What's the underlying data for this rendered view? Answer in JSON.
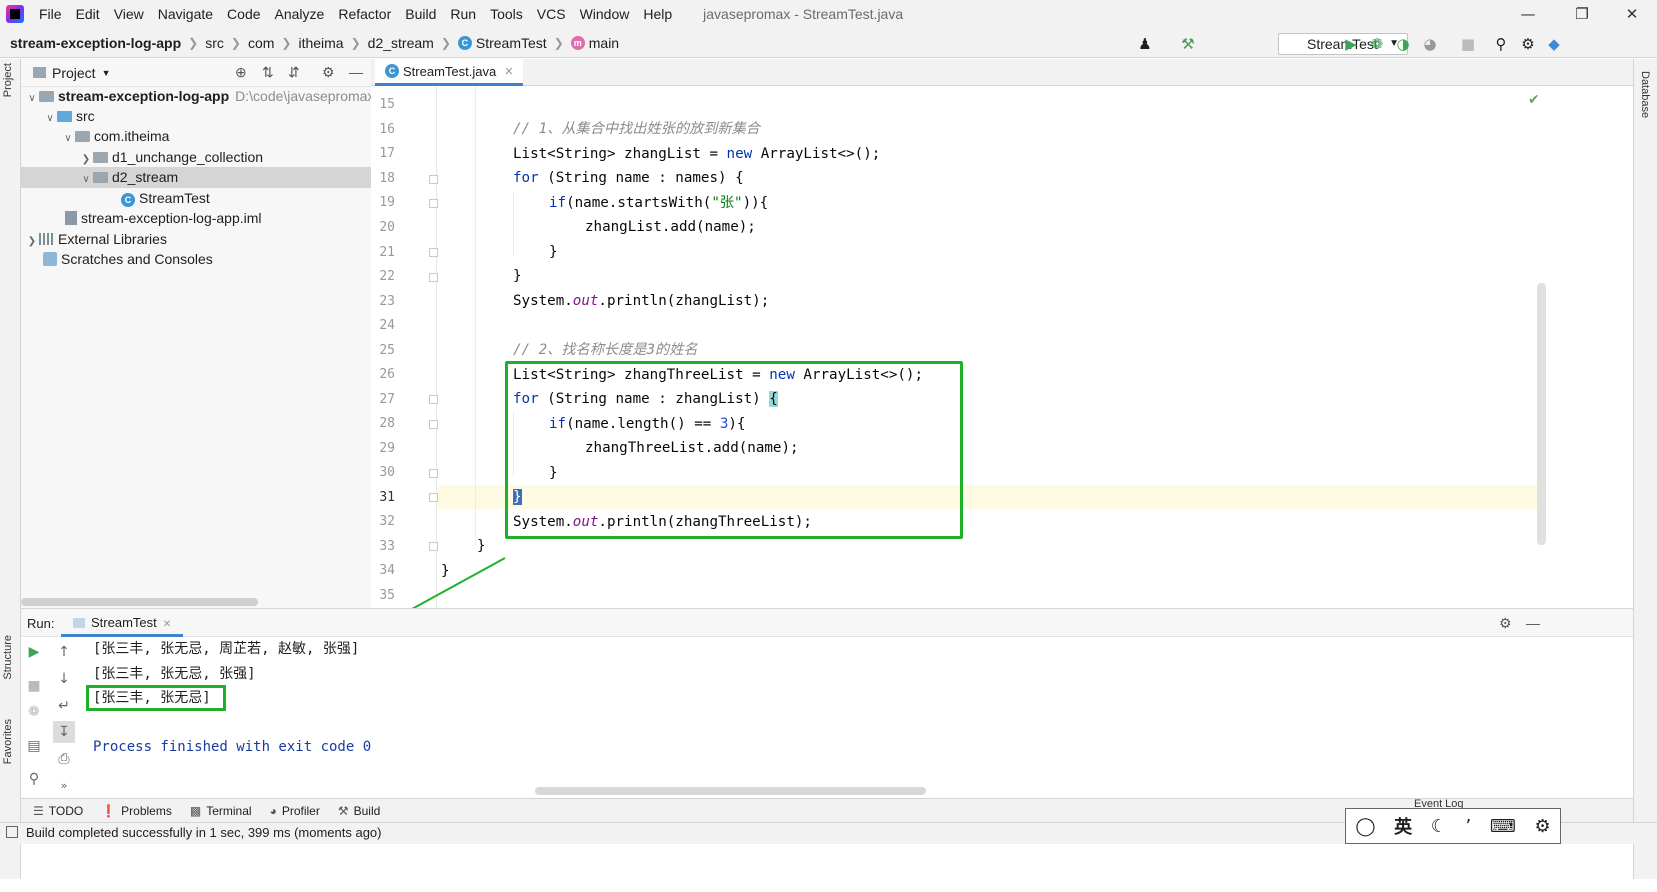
{
  "menubar": {
    "items": [
      "File",
      "Edit",
      "View",
      "Navigate",
      "Code",
      "Analyze",
      "Refactor",
      "Build",
      "Run",
      "Tools",
      "VCS",
      "Window",
      "Help"
    ],
    "window_title": "javasepromax - StreamTest.java"
  },
  "navbar": {
    "crumbs": [
      "stream-exception-log-app",
      "src",
      "com",
      "itheima",
      "d2_stream",
      "StreamTest",
      "main"
    ]
  },
  "toolbar": {
    "run_config": "StreamTest"
  },
  "project": {
    "header": "Project",
    "tree": [
      {
        "label": "stream-exception-log-app",
        "hint": "D:\\code\\javasepromax"
      },
      {
        "label": "src"
      },
      {
        "label": "com.itheima"
      },
      {
        "label": "d1_unchange_collection"
      },
      {
        "label": "d2_stream"
      },
      {
        "label": "StreamTest"
      },
      {
        "label": "stream-exception-log-app.iml"
      },
      {
        "label": "External Libraries"
      },
      {
        "label": "Scratches and Consoles"
      }
    ]
  },
  "editor": {
    "tab": "StreamTest.java",
    "line_numbers": [
      "15",
      "16",
      "17",
      "18",
      "19",
      "20",
      "21",
      "22",
      "23",
      "24",
      "25",
      "26",
      "27",
      "28",
      "29",
      "30",
      "31",
      "32",
      "33",
      "34",
      "35"
    ],
    "comment1": "// 1、从集合中找出姓张的放到新集合",
    "comment2": "// 2、找名称长度是3的姓名",
    "string_zhang": "\"张\"",
    "number_three": "3"
  },
  "run": {
    "label": "Run:",
    "tab": "StreamTest",
    "output": [
      "[张三丰, 张无忌, 周芷若, 赵敏, 张强]",
      "[张三丰, 张无忌, 张强]",
      "[张三丰, 张无忌]",
      "",
      "Process finished with exit code 0"
    ]
  },
  "tool_tabs": [
    "TODO",
    "Problems",
    "Terminal",
    "Profiler",
    "Build"
  ],
  "side_tabs": {
    "left_top": "Project",
    "left_mid": "Structure",
    "left_bottom": "Favorites",
    "right": "Database"
  },
  "statusbar": {
    "message": "Build completed successfully in 1 sec, 399 ms (moments ago)"
  },
  "event_log": "Event Log",
  "ime": {
    "lang": "英"
  },
  "colors": {
    "accent": "#4083c9",
    "highlight_box": "#1fb12a",
    "keyword": "#0033b3",
    "comment": "#8c8c8c",
    "string": "#067d17"
  }
}
